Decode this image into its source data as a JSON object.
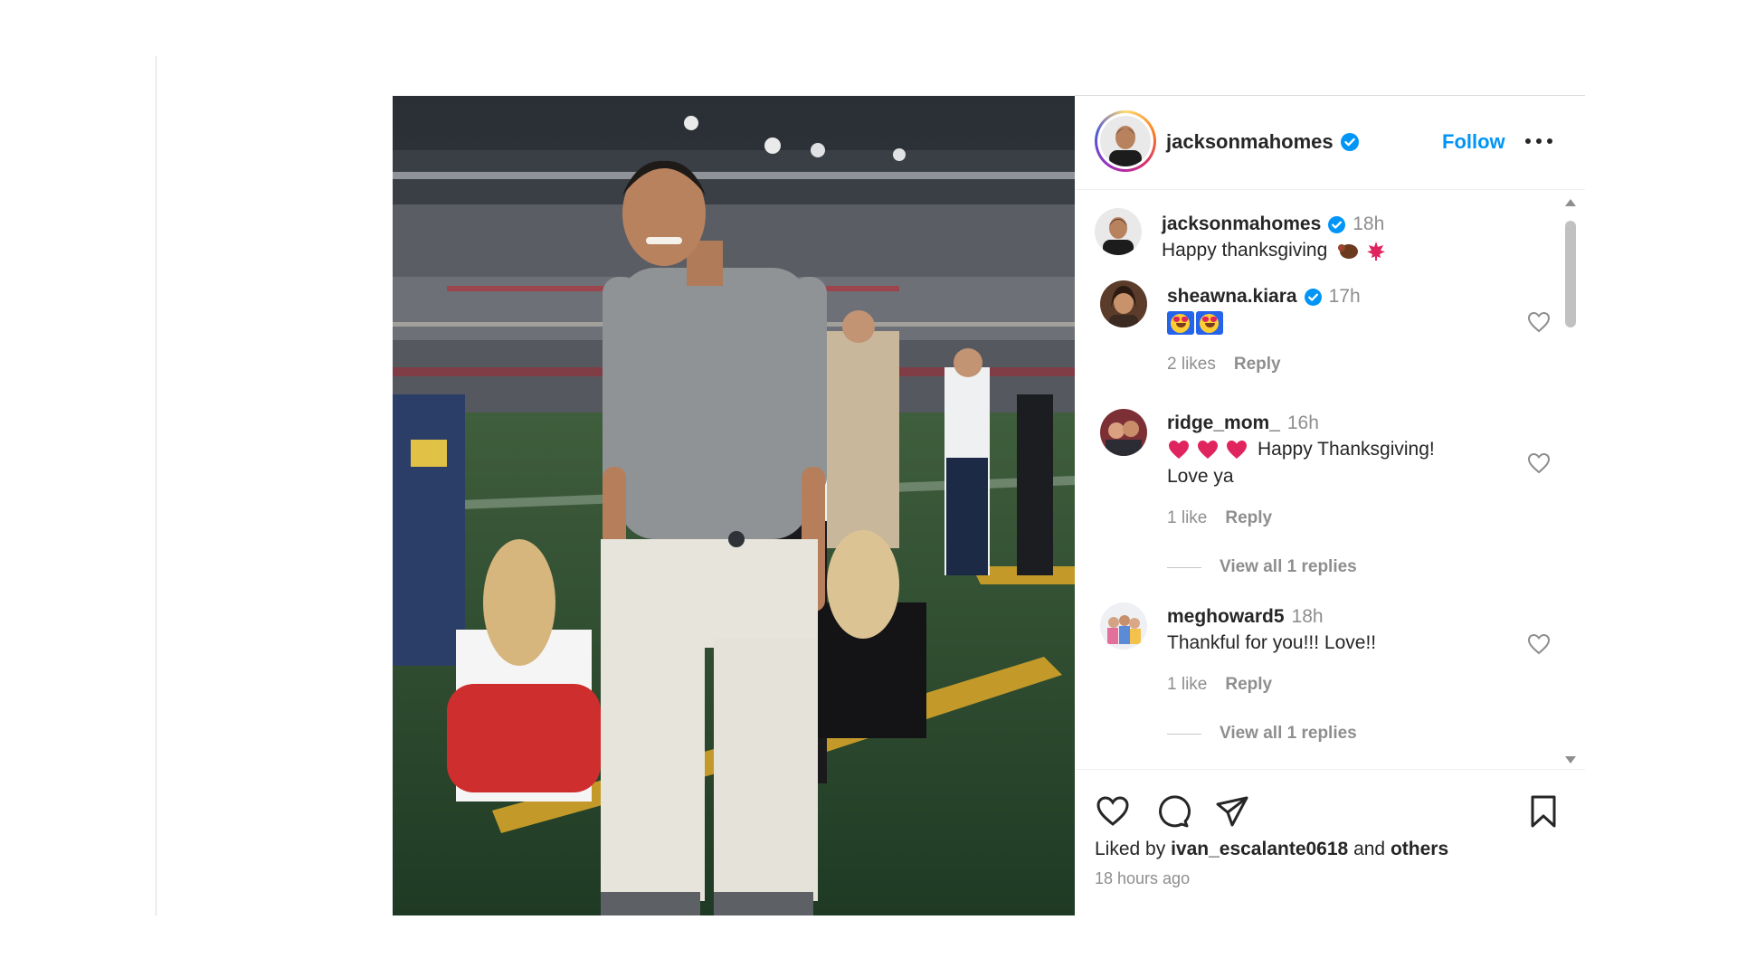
{
  "post": {
    "author": {
      "username": "jacksonmahomes",
      "verified": true,
      "follow_label": "Follow"
    },
    "caption": {
      "username": "jacksonmahomes",
      "time": "18h",
      "text": "Happy thanksgiving"
    },
    "comments": [
      {
        "username": "sheawna.kiara",
        "verified": true,
        "time": "17h",
        "text": "",
        "emoji": "star-struck-emoji x2",
        "likes": "2 likes",
        "reply_label": "Reply"
      },
      {
        "username": "ridge_mom_",
        "verified": false,
        "time": "16h",
        "text_line1": "Happy Thanksgiving!",
        "text_line2": "Love ya",
        "likes": "1 like",
        "reply_label": "Reply",
        "view_replies": "View all 1 replies"
      },
      {
        "username": "meghoward5",
        "verified": false,
        "time": "18h",
        "text": "Thankful for you!!! Love!!",
        "likes": "1 like",
        "reply_label": "Reply",
        "view_replies": "View all 1 replies"
      }
    ],
    "liked_by": {
      "prefix": "Liked by",
      "user": "ivan_escalante0618",
      "connector": "and",
      "others": "others"
    },
    "timestamp": "18 hours ago"
  },
  "colors": {
    "accent": "#0095f6",
    "text": "#262626",
    "muted": "#8e8e8e"
  },
  "icons": [
    "verified-badge-icon",
    "more-options-icon",
    "heart-icon",
    "comment-icon",
    "share-icon",
    "bookmark-icon",
    "scroll-up-icon",
    "scroll-down-icon"
  ]
}
